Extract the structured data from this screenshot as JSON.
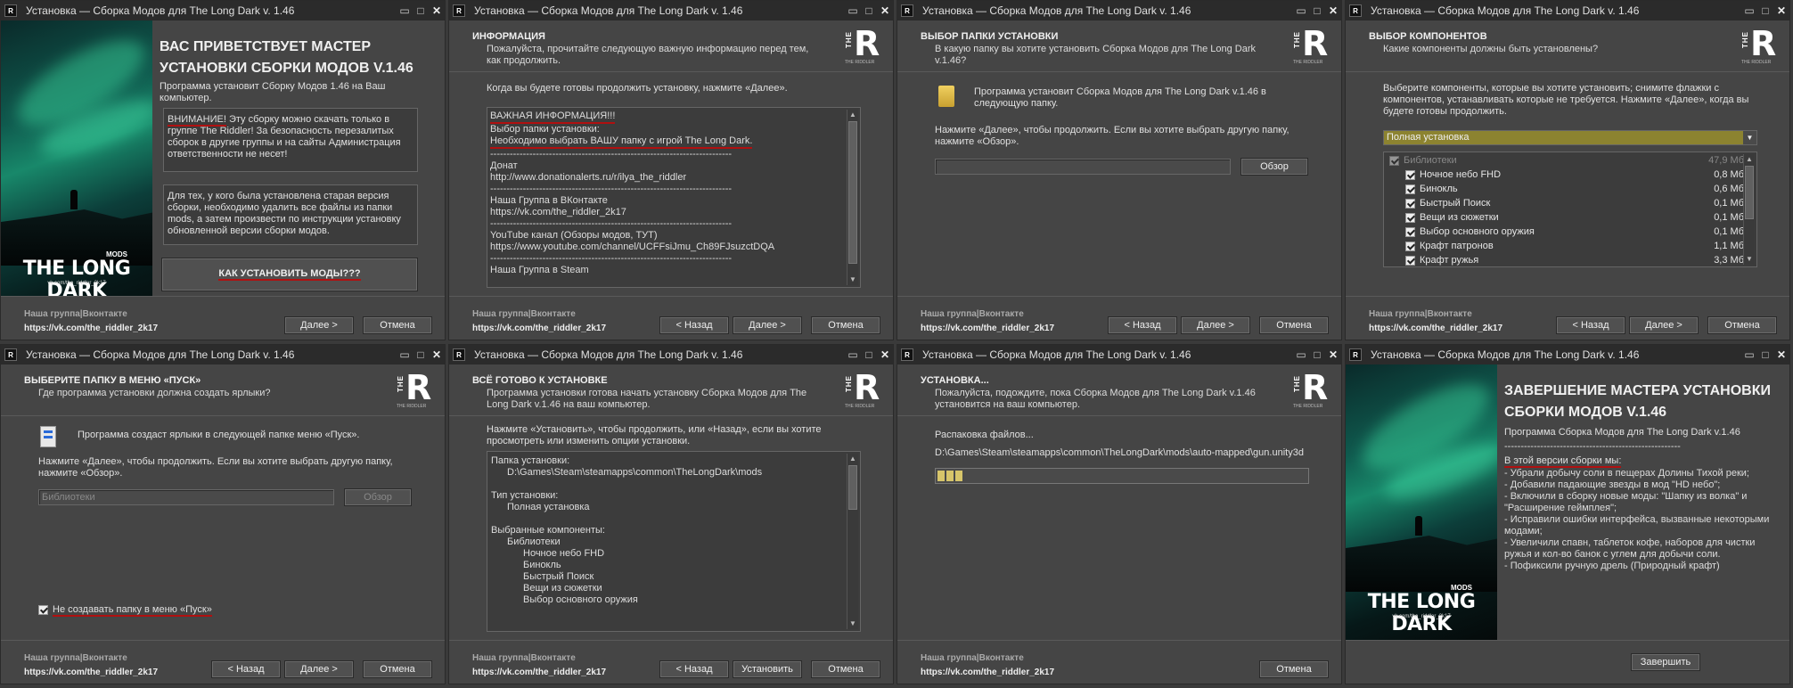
{
  "window_title": "Установка — Сборка Модов для The Long Dark v. 1.46",
  "app_icon_text": "R",
  "logo": {
    "the": "THE",
    "r": "R",
    "sub": "THE RIDDLER"
  },
  "footer": {
    "group_label": "Наша группа|Вконтакте",
    "group_url": "https://vk.com/the_riddler_2k17"
  },
  "buttons": {
    "next": "Далее >",
    "back": "< Назад",
    "cancel": "Отмена",
    "install": "Установить",
    "finish": "Завершить",
    "browse": "Обзор"
  },
  "colors": {
    "background": "#454545",
    "titlebar": "#2b2b2b",
    "accent_underline": "#b01010",
    "component_dropdown": "#8c8330",
    "progress": "#d7c56a"
  },
  "image_panel": {
    "title": "THE LONG DARK",
    "mods": "MODS",
    "vk": "vk.com/the_riddler_2k17"
  },
  "welcome": {
    "title_line1": "ВАС ПРИВЕТСТВУЕТ МАСТЕР",
    "title_line2": "УСТАНОВКИ СБОРКИ МОДОВ V.1.46",
    "intro": "Программа установит Сборку Модов 1.46 на Ваш компьютер.",
    "warn_word": "ВНИМАНИЕ!",
    "warn_rest": " Эту сборку можно скачать только в группе The Riddler! За безопасность перезалитых сборок в другие группы и на сайты Администрация ответственности не несет!",
    "update_note": "Для тех, у кого была установлена старая версия сборки, необходимо удалить все файлы из папки mods, а затем произвести по инструкции установку обновленной версии сборки модов.",
    "howto_button": "КАК УСТАНОВИТЬ МОДЫ???"
  },
  "info": {
    "h1": "ИНФОРМАЦИЯ",
    "h2": "Пожалуйста, прочитайте следующую важную информацию перед тем, как продолжить.",
    "ready": "Когда вы будете готовы продолжить установку, нажмите «Далее».",
    "lines": [
      "ВАЖНАЯ ИНФОРМАЦИЯ!!!",
      "Выбор папки установки:",
      "Необходимо выбрать ВАШУ папку с игрой The Long Dark.",
      "--------------------------------------------------------------------------",
      "Донат",
      "http://www.donationalerts.ru/r/ilya_the_riddler",
      "--------------------------------------------------------------------------",
      "Наша Группа в ВКонтакте",
      "https://vk.com/the_riddler_2k17",
      "--------------------------------------------------------------------------",
      "YouTube канал (Обзоры модов, ТУТ)",
      "https://www.youtube.com/channel/UCFFsiJmu_Ch89FJsuzctDQA",
      "--------------------------------------------------------------------------",
      "Наша Группа в Steam"
    ]
  },
  "folder": {
    "h1": "ВЫБОР ПАПКИ УСТАНОВКИ",
    "h2": "В какую папку вы хотите установить Сборка Модов для The Long Dark v.1.46?",
    "will_install": "Программа установит Сборка Модов для The Long Dark v.1.46 в следующую папку.",
    "press_next": "Нажмите «Далее», чтобы продолжить. Если вы хотите выбрать другую папку, нажмите «Обзор».",
    "path_value": ""
  },
  "components": {
    "h1": "ВЫБОР КОМПОНЕНТОВ",
    "h2": "Какие компоненты должны быть установлены?",
    "desc": "Выберите компоненты, которые вы хотите установить; снимите флажки с компонентов, устанавливать которые не требуется. Нажмите «Далее», когда вы будете готовы продолжить.",
    "type_selected": "Полная установка",
    "items": [
      {
        "label": "Библиотеки",
        "size": "47,9 Мб",
        "disabled": true
      },
      {
        "label": "Ночное небо FHD",
        "size": "0,8 Мб"
      },
      {
        "label": "Бинокль",
        "size": "0,6 Мб"
      },
      {
        "label": "Быстрый Поиск",
        "size": "0,1 Мб"
      },
      {
        "label": "Вещи из сюжетки",
        "size": "0,1 Мб"
      },
      {
        "label": "Выбор основного оружия",
        "size": "0,1 Мб"
      },
      {
        "label": "Крафт патронов",
        "size": "1,1 Мб"
      },
      {
        "label": "Крафт ружья",
        "size": "3,3 Мб"
      }
    ]
  },
  "startmenu": {
    "h1": "ВЫБЕРИТЕ ПАПКУ В МЕНЮ «ПУСК»",
    "h2": "Где программа установки должна создать ярлыки?",
    "will_create": "Программа создаст ярлыки в следующей папке меню «Пуск».",
    "press_next": "Нажмите «Далее», чтобы продолжить. Если вы хотите выбрать другую папку, нажмите «Обзор».",
    "folder_value": "Библиотеки",
    "nocreate": "Не создавать папку в меню «Пуск»"
  },
  "ready": {
    "h1": "ВСЁ ГОТОВО К УСТАНОВКЕ",
    "h2": "Программа установки готова начать установку Сборка Модов для The Long Dark v.1.46 на ваш компьютер.",
    "press": "Нажмите «Установить», чтобы продолжить, или «Назад», если вы хотите просмотреть или изменить опции установки.",
    "lines": [
      {
        "t": "Папка установки:",
        "i": 0
      },
      {
        "t": "D:\\Games\\Steam\\steamapps\\common\\TheLongDark\\mods",
        "i": 1
      },
      {
        "t": "",
        "i": 0
      },
      {
        "t": "Тип установки:",
        "i": 0
      },
      {
        "t": "Полная установка",
        "i": 1
      },
      {
        "t": "",
        "i": 0
      },
      {
        "t": "Выбранные компоненты:",
        "i": 0
      },
      {
        "t": "Библиотеки",
        "i": 1
      },
      {
        "t": "Ночное небо FHD",
        "i": 2
      },
      {
        "t": "Бинокль",
        "i": 2
      },
      {
        "t": "Быстрый Поиск",
        "i": 2
      },
      {
        "t": "Вещи из сюжетки",
        "i": 2
      },
      {
        "t": "Выбор основного оружия",
        "i": 2
      }
    ]
  },
  "installing": {
    "h1": "УСТАНОВКА...",
    "h2": "Пожалуйста, подождите, пока Сборка Модов для The Long Dark v.1.46 установится на ваш компьютер.",
    "status": "Распаковка файлов...",
    "file": "D:\\Games\\Steam\\steamapps\\common\\TheLongDark\\mods\\auto-mapped\\gun.unity3d",
    "progress_fraction": 0.07
  },
  "finish": {
    "title_line1": "ЗАВЕРШЕНИЕ МАСТЕРА УСТАНОВКИ",
    "title_line2": "СБОРКИ МОДОВ V.1.46",
    "product": "Программа Сборка Модов для The Long Dark v.1.46",
    "sep": "------------------------------------------------------",
    "changes_title": "В этой версии сборки мы:",
    "changes": [
      "- Убрали добычу соли в пещерах Долины Тихой реки;",
      "- Добавили падающие звезды в мод \"HD небо\";",
      "- Включили в сборку новые моды: \"Шапку из волка\" и \"Расширение геймплея\";",
      "- Исправили ошибки интерфейса, вызванные некоторыми модами;",
      "- Увеличили спавн, таблеток кофе, наборов для чистки ружья и кол-во банок с углем для добычи соли.",
      "- Пофиксили ручную дрель (Природный крафт)"
    ]
  }
}
